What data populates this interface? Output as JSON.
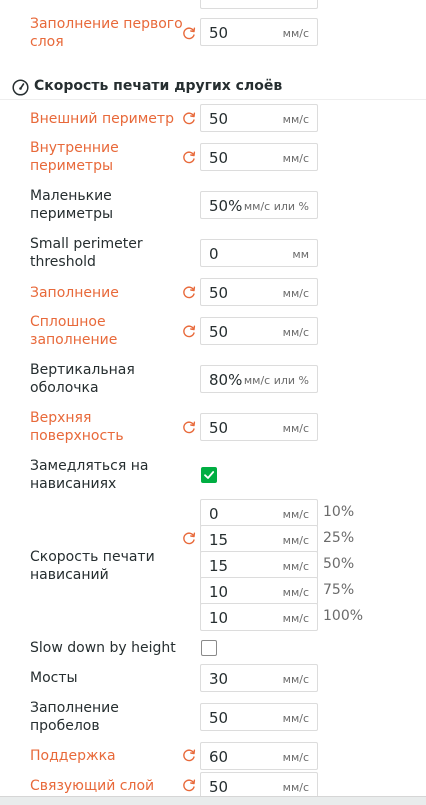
{
  "colors": {
    "modified": "#e8693a",
    "text": "#262e30",
    "accent": "#00ae42"
  },
  "first_layer_infill": {
    "label": "Заполнение первого слоя",
    "value": "50",
    "unit": "мм/с"
  },
  "section": {
    "title": "Скорость печати других слоёв",
    "icon": "speedometer-icon"
  },
  "outer_wall": {
    "label": "Внешний периметр",
    "value": "50",
    "unit": "мм/с"
  },
  "inner_wall": {
    "label": "Внутренние периметры",
    "value": "50",
    "unit": "мм/с"
  },
  "small_perimeters": {
    "label": "Маленькие периметры",
    "value": "50%",
    "unit": "мм/с или %"
  },
  "small_perimeter_threshold": {
    "label": "Small perimeter threshold",
    "value": "0",
    "unit": "мм"
  },
  "sparse_infill": {
    "label": "Заполнение",
    "value": "50",
    "unit": "мм/с"
  },
  "solid_infill": {
    "label": "Сплошное заполнение",
    "value": "50",
    "unit": "мм/с"
  },
  "vertical_shell": {
    "label": "Вертикальная оболочка",
    "value": "80%",
    "unit": "мм/с или %"
  },
  "top_surface": {
    "label": "Верхняя поверхность",
    "value": "50",
    "unit": "мм/с"
  },
  "slow_down_overhangs": {
    "label": "Замедляться на нависаниях",
    "checked": true
  },
  "overhang_speed": {
    "label": "Скорость печати нависаний",
    "rows": [
      {
        "value": "0",
        "unit": "мм/с",
        "pct": "10%"
      },
      {
        "value": "15",
        "unit": "мм/с",
        "pct": "25%"
      },
      {
        "value": "15",
        "unit": "мм/с",
        "pct": "50%"
      },
      {
        "value": "10",
        "unit": "мм/с",
        "pct": "75%"
      },
      {
        "value": "10",
        "unit": "мм/с",
        "pct": "100%"
      }
    ]
  },
  "slow_down_by_height": {
    "label": "Slow down by height",
    "checked": false
  },
  "bridges": {
    "label": "Мосты",
    "value": "30",
    "unit": "мм/с"
  },
  "gap_fill": {
    "label": "Заполнение пробелов",
    "value": "50",
    "unit": "мм/с"
  },
  "support": {
    "label": "Поддержка",
    "value": "60",
    "unit": "мм/с"
  },
  "support_interface": {
    "label": "Связующий слой",
    "value": "50",
    "unit": "мм/с"
  }
}
